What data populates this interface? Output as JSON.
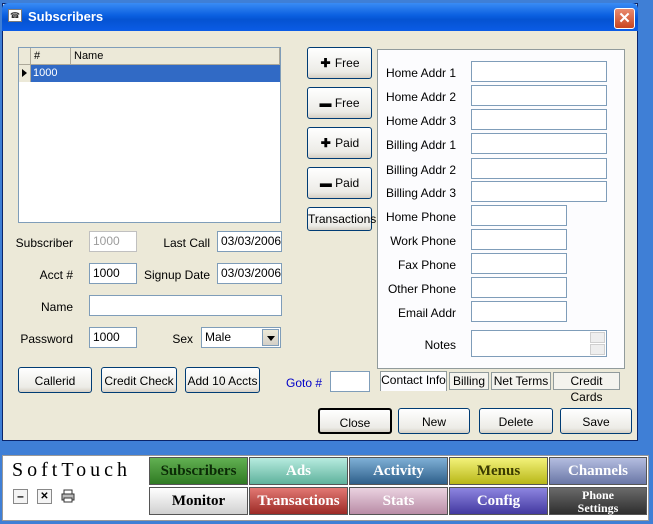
{
  "window": {
    "title": "Subscribers",
    "close_symbol": "✕"
  },
  "grid": {
    "columns": [
      "#",
      "Name"
    ],
    "rows": [
      {
        "num": "1000",
        "name": ""
      }
    ]
  },
  "form": {
    "subscriber_label": "Subscriber",
    "subscriber_value": "1000",
    "last_call_label": "Last Call",
    "last_call_value": "03/03/2006",
    "acct_label": "Acct #",
    "acct_value": "1000",
    "signup_label": "Signup Date",
    "signup_value": "03/03/2006",
    "name_label": "Name",
    "name_value": "",
    "password_label": "Password",
    "password_value": "1000",
    "sex_label": "Sex",
    "sex_value": "Male",
    "goto_label": "Goto #",
    "goto_value": ""
  },
  "side_buttons": {
    "free_plus": "Free",
    "free_minus": "Free",
    "paid_plus": "Paid",
    "paid_minus": "Paid",
    "transactions": "Transactions",
    "plus_symbol": "✚",
    "minus_symbol": "▬"
  },
  "left_buttons": {
    "callerid": "Callerid",
    "credit_check": "Credit Check",
    "add10": "Add 10 Accts"
  },
  "contact": {
    "home1": "Home Addr 1",
    "home2": "Home Addr 2",
    "home3": "Home Addr 3",
    "bill1": "Billing Addr 1",
    "bill2": "Billing Addr 2",
    "bill3": "Billing Addr 3",
    "home_phone": "Home Phone",
    "work_phone": "Work Phone",
    "fax_phone": "Fax Phone",
    "other_phone": "Other Phone",
    "email": "Email Addr",
    "notes": "Notes"
  },
  "tabs": [
    "Contact Info",
    "Billing",
    "Net Terms",
    "Credit Cards"
  ],
  "actions": {
    "close": "Close",
    "new": "New",
    "delete": "Delete",
    "save": "Save"
  },
  "nav": {
    "brand": "SoftTouch",
    "min_symbol": "–",
    "close_symbol": "✕",
    "row1": [
      "Subscribers",
      "Ads",
      "Activity",
      "Menus",
      "Channels"
    ],
    "row2": [
      "Monitor",
      "Transactions",
      "Stats",
      "Config",
      "Phone Settings"
    ]
  },
  "colors": {
    "titlebar": "#0553d2",
    "selection": "#316ac5",
    "goto_label": "#0000c8",
    "nav_subscribers": "#3c8a2e",
    "nav_ads": "#7fc7b5",
    "nav_activity": "#3a6f9a",
    "nav_menus": "#d7d62b",
    "nav_channels": "#7f8cb8",
    "nav_monitor": "#e8e8e8",
    "nav_transactions": "#b73a35",
    "nav_stats": "#cfa9c0",
    "nav_config": "#5b52b4",
    "nav_phone": "#474747"
  }
}
